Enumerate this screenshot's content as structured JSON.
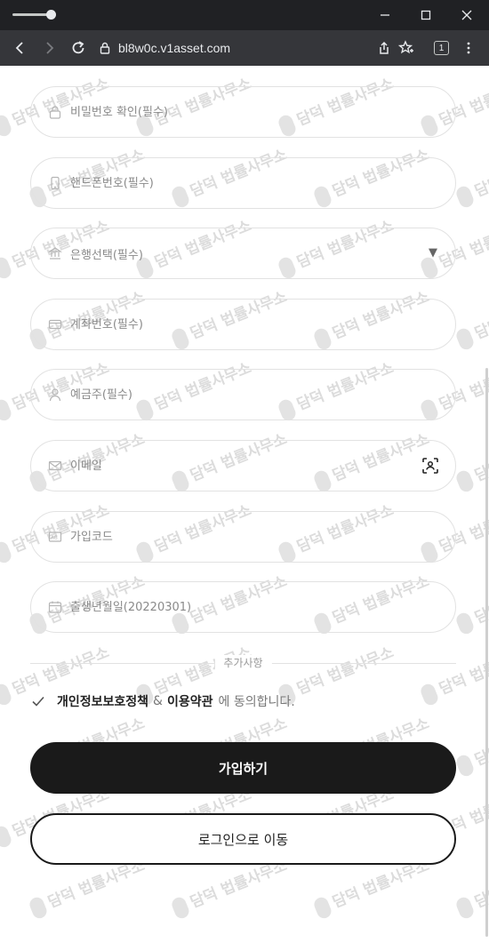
{
  "browser": {
    "url": "bl8w0c.v1asset.com",
    "tab_count": "1"
  },
  "form": {
    "fields": [
      {
        "placeholder": "비밀번호 확인(필수)",
        "icon": "lock-icon"
      },
      {
        "placeholder": "핸드폰번호(필수)",
        "icon": "phone-icon"
      },
      {
        "placeholder": "은행선택(필수)",
        "icon": "bank-icon"
      },
      {
        "placeholder": "계좌번호(필수)",
        "icon": "card-icon"
      },
      {
        "placeholder": "예금주(필수)",
        "icon": "person-icon"
      },
      {
        "placeholder": "이메일",
        "icon": "mail-icon"
      },
      {
        "placeholder": "가입코드",
        "icon": "code-icon"
      },
      {
        "placeholder": "출생년월일(20220301)",
        "icon": "calendar-icon"
      }
    ],
    "divider_label": "추가사항",
    "agreement": {
      "privacy": "개인정보보호정책",
      "and": "&",
      "terms": "이용약관",
      "suffix": "에 동의합니다."
    },
    "signup_button": "가입하기",
    "login_button": "로그인으로 이동"
  },
  "watermark_text": "담덕 법률사무소",
  "colors": {
    "primary_button": "#1a1a1a",
    "field_border": "#e2e2e2",
    "chrome_dark": "#202124"
  }
}
